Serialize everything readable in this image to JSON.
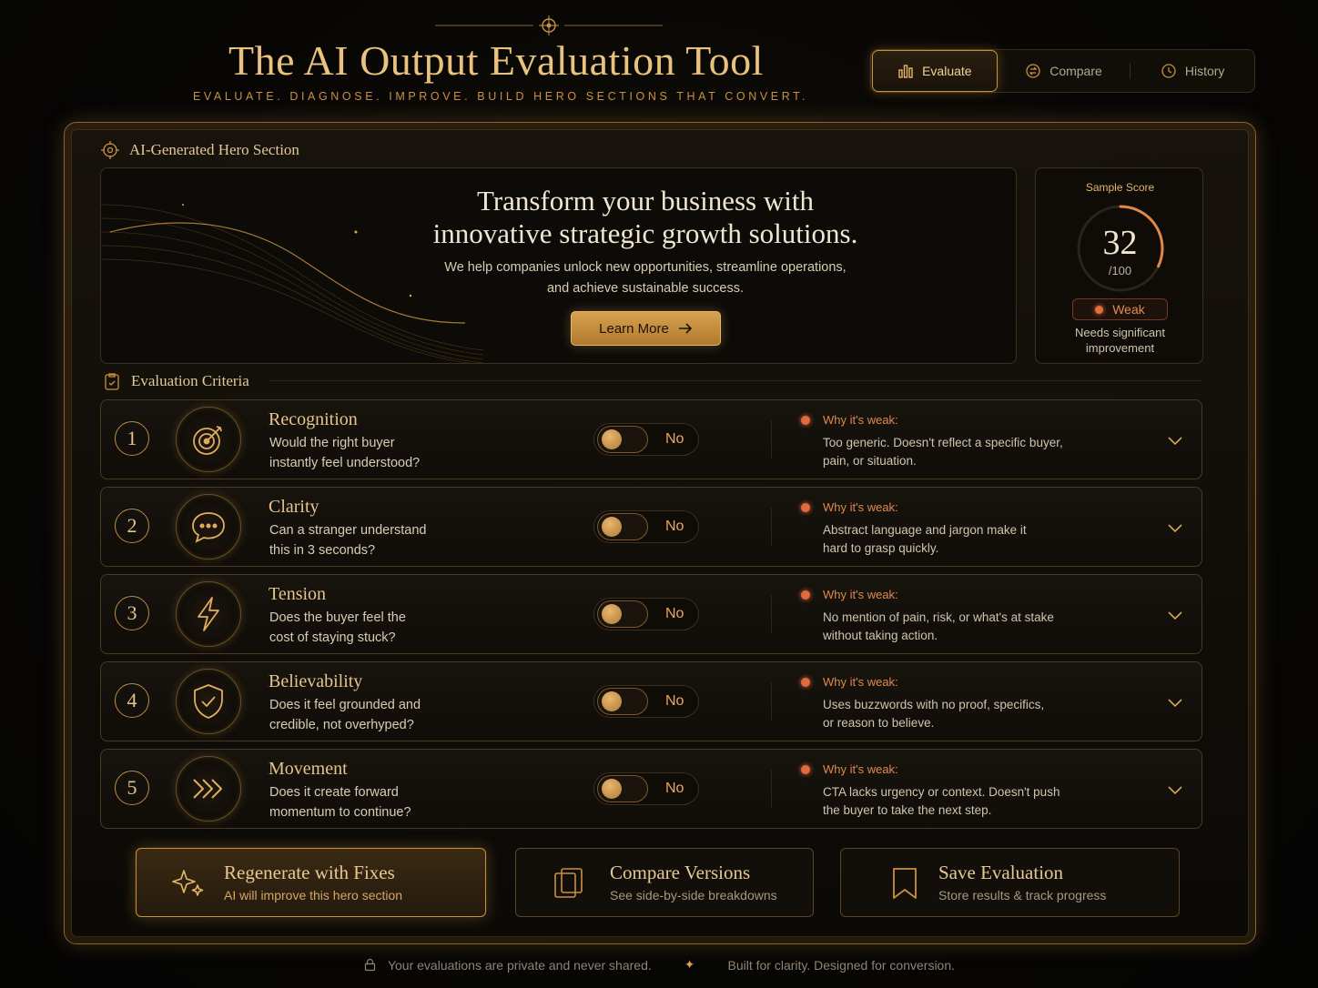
{
  "header": {
    "title": "The AI Output Evaluation Tool",
    "subtitle": "EVALUATE. DIAGNOSE. IMPROVE. BUILD HERO SECTIONS THAT CONVERT.",
    "tabs": [
      {
        "label": "Evaluate",
        "icon": "bar-chart-icon",
        "active": true
      },
      {
        "label": "Compare",
        "icon": "compare-icon",
        "active": false
      },
      {
        "label": "History",
        "icon": "history-icon",
        "active": false
      }
    ]
  },
  "hero_section": {
    "label": "AI-Generated Hero Section",
    "headline_line1": "Transform your business with",
    "headline_line2": "innovative strategic growth solutions.",
    "body_line1": "We help companies unlock new opportunities, streamline operations,",
    "body_line2": "and achieve sustainable success.",
    "cta_label": "Learn More"
  },
  "score": {
    "label": "Sample Score",
    "value": "32",
    "max": "/100",
    "fraction": 0.32,
    "badge": "Weak",
    "note_line1": "Needs significant",
    "note_line2": "improvement"
  },
  "criteria": {
    "label": "Evaluation Criteria",
    "why_label": "Why it's weak:",
    "items": [
      {
        "number": "1",
        "title": "Recognition",
        "question_line1": "Would the right buyer",
        "question_line2": "instantly feel understood?",
        "toggle": "No",
        "why_line1": "Too generic. Doesn't reflect a specific buyer,",
        "why_line2": "pain, or situation.",
        "icon": "target-icon"
      },
      {
        "number": "2",
        "title": "Clarity",
        "question_line1": "Can a stranger understand",
        "question_line2": "this in 3 seconds?",
        "toggle": "No",
        "why_line1": "Abstract language and jargon make it",
        "why_line2": "hard to grasp quickly.",
        "icon": "chat-bubble-icon"
      },
      {
        "number": "3",
        "title": "Tension",
        "question_line1": "Does the buyer feel the",
        "question_line2": "cost of staying stuck?",
        "toggle": "No",
        "why_line1": "No mention of pain, risk, or what's at stake",
        "why_line2": "without taking action.",
        "icon": "lightning-icon"
      },
      {
        "number": "4",
        "title": "Believability",
        "question_line1": "Does it feel grounded and",
        "question_line2": "credible, not overhyped?",
        "toggle": "No",
        "why_line1": "Uses buzzwords with no proof, specifics,",
        "why_line2": "or reason to believe.",
        "icon": "shield-check-icon"
      },
      {
        "number": "5",
        "title": "Movement",
        "question_line1": "Does it create forward",
        "question_line2": "momentum to continue?",
        "toggle": "No",
        "why_line1": "CTA lacks urgency or context. Doesn't push",
        "why_line2": "the buyer to take the next step.",
        "icon": "forward-chevrons-icon"
      }
    ]
  },
  "actions": [
    {
      "title": "Regenerate with Fixes",
      "subtitle": "AI will improve this hero section",
      "icon": "sparkle-icon"
    },
    {
      "title": "Compare Versions",
      "subtitle": "See side-by-side breakdowns",
      "icon": "copy-icon"
    },
    {
      "title": "Save Evaluation",
      "subtitle": "Store results & track progress",
      "icon": "bookmark-icon"
    }
  ],
  "footer": {
    "privacy": "Your evaluations are private and never shared.",
    "tagline": "Built for clarity. Designed for conversion."
  },
  "colors": {
    "accent_gold": "#c9913f",
    "warning_orange": "#e06a3a",
    "background": "#070605"
  }
}
